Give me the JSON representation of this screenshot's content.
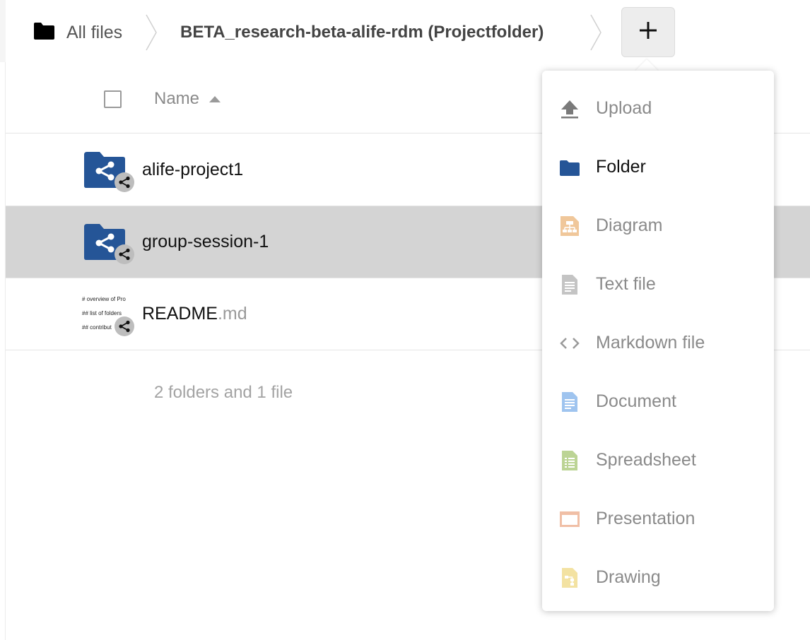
{
  "breadcrumb": {
    "home_label": "All files",
    "current_label": "BETA_research-beta-alife-rdm (Projectfolder)",
    "add_button_symbol": "+"
  },
  "table": {
    "column_name": "Name",
    "sort_direction": "ascending",
    "rows": [
      {
        "name": "alife-project1",
        "ext": "",
        "type": "shared-folder",
        "selected": false
      },
      {
        "name": "group-session-1",
        "ext": "",
        "type": "shared-folder",
        "selected": true
      },
      {
        "name": "README",
        "ext": ".md",
        "type": "markdown-file",
        "selected": false,
        "preview_lines": [
          "# overview of Pro",
          "## list of folders",
          "## contribut"
        ]
      }
    ],
    "summary": "2 folders and 1 file"
  },
  "new_menu": {
    "items": [
      {
        "label": "Upload",
        "icon": "upload-icon"
      },
      {
        "label": "Folder",
        "icon": "folder-icon"
      },
      {
        "label": "Diagram",
        "icon": "diagram-icon"
      },
      {
        "label": "Text file",
        "icon": "text-file-icon"
      },
      {
        "label": "Markdown file",
        "icon": "code-icon"
      },
      {
        "label": "Document",
        "icon": "document-icon"
      },
      {
        "label": "Spreadsheet",
        "icon": "spreadsheet-icon"
      },
      {
        "label": "Presentation",
        "icon": "presentation-icon"
      },
      {
        "label": "Drawing",
        "icon": "drawing-icon"
      }
    ]
  },
  "colors": {
    "folder_blue": "#255597",
    "selected_row": "#d4d4d4",
    "diagram": "#f0c79a",
    "document": "#9fc4ef",
    "spreadsheet": "#bcd495",
    "presentation": "#f0bfa6",
    "drawing": "#f3e2a2"
  }
}
